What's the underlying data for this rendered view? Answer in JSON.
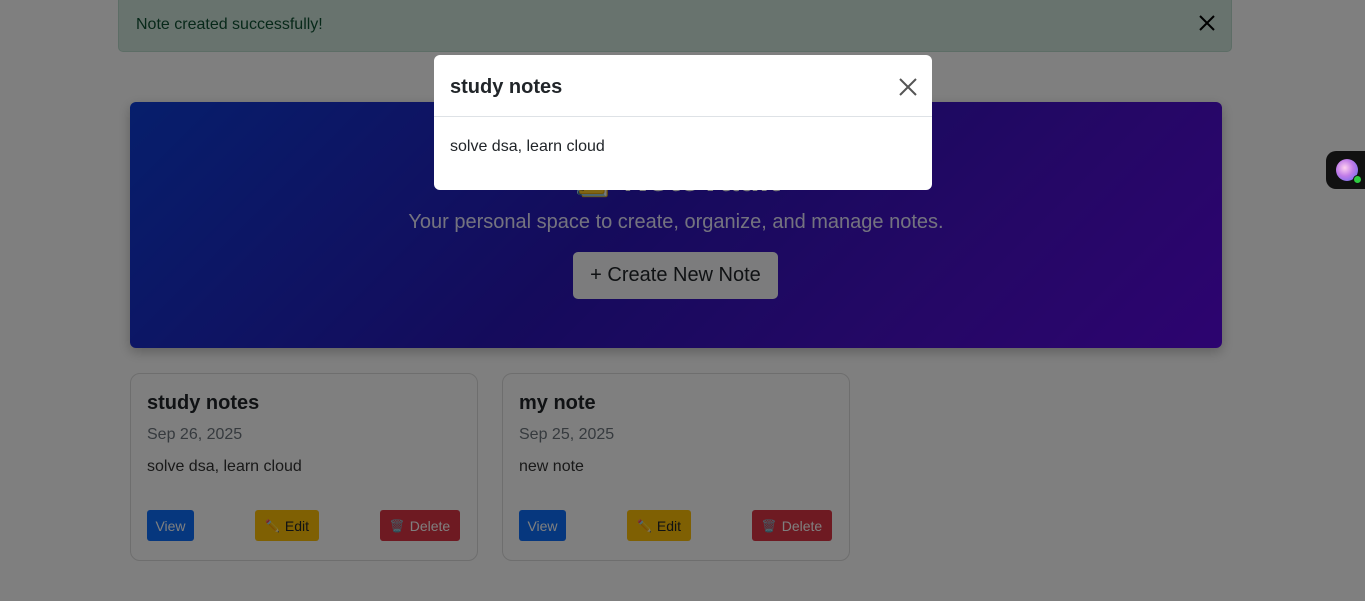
{
  "alert": {
    "message": "Note created successfully!",
    "close_icon": "close-icon"
  },
  "hero": {
    "title": "📒 NoteVault",
    "subtitle": "Your personal space to create, organize, and manage notes.",
    "create_button": "+ Create New Note"
  },
  "notes": [
    {
      "title": "study notes",
      "date": "Sep 26, 2025",
      "content": "solve dsa, learn cloud",
      "view_label": "View",
      "edit_label": "Edit",
      "delete_label": "Delete"
    },
    {
      "title": "my note",
      "date": "Sep 25, 2025",
      "content": "new note",
      "view_label": "View",
      "edit_label": "Edit",
      "delete_label": "Delete"
    }
  ],
  "modal": {
    "title": "study notes",
    "body": "solve dsa, learn cloud",
    "close_icon": "close-icon"
  },
  "icons": {
    "edit": "✏️",
    "delete": "🗑️"
  },
  "colors": {
    "view": "#0d6efd",
    "edit": "#ffc107",
    "delete": "#dc3545",
    "alert_bg": "#d1e7dd"
  }
}
